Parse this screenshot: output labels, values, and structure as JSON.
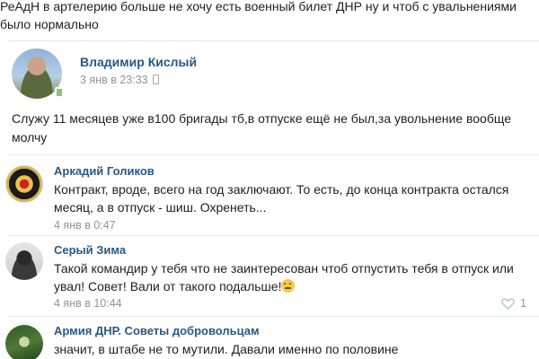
{
  "top_fragment": {
    "text": "РеАдН в артелерию больше не хочу есть военный билет ДНР ну и чтоб с увальнениями было нормально"
  },
  "post": {
    "author": "Владимир Кислый",
    "time": "3 янв в 23:33",
    "text": "Служу 11 месяцев уже в100 бригады тб,в отпуске ещё не был,за увольнение вообще молчу",
    "device_icon": "phone-icon"
  },
  "comments": [
    {
      "author": "Аркадий Голиков",
      "text": "Контракт, вроде, всего на год заключают. То есть, до конца контракта остался месяц, а в отпуск - шиш. Охренеть...",
      "time": "4 янв в 0:47",
      "avatar": "emblem-avatar"
    },
    {
      "author": "Серый Зима",
      "text": "Такой командир у тебя что не заинтересован чтоб отпустить тебя в отпуск или увал! Совет! Вали от такого подальше!",
      "time": "4 янв в 10:44",
      "likes": "1",
      "emoji": "smile-emoji",
      "avatar": "soldier-avatar"
    },
    {
      "author": "Армия ДНР. Советы добровольцам",
      "text": "значит, в штабе не то мутили. Давали именно по половине",
      "avatar": "army-avatar"
    }
  ],
  "colors": {
    "link": "#2a5885",
    "muted": "#939393",
    "divider": "#e7e8ec",
    "online": "#8ac176"
  }
}
